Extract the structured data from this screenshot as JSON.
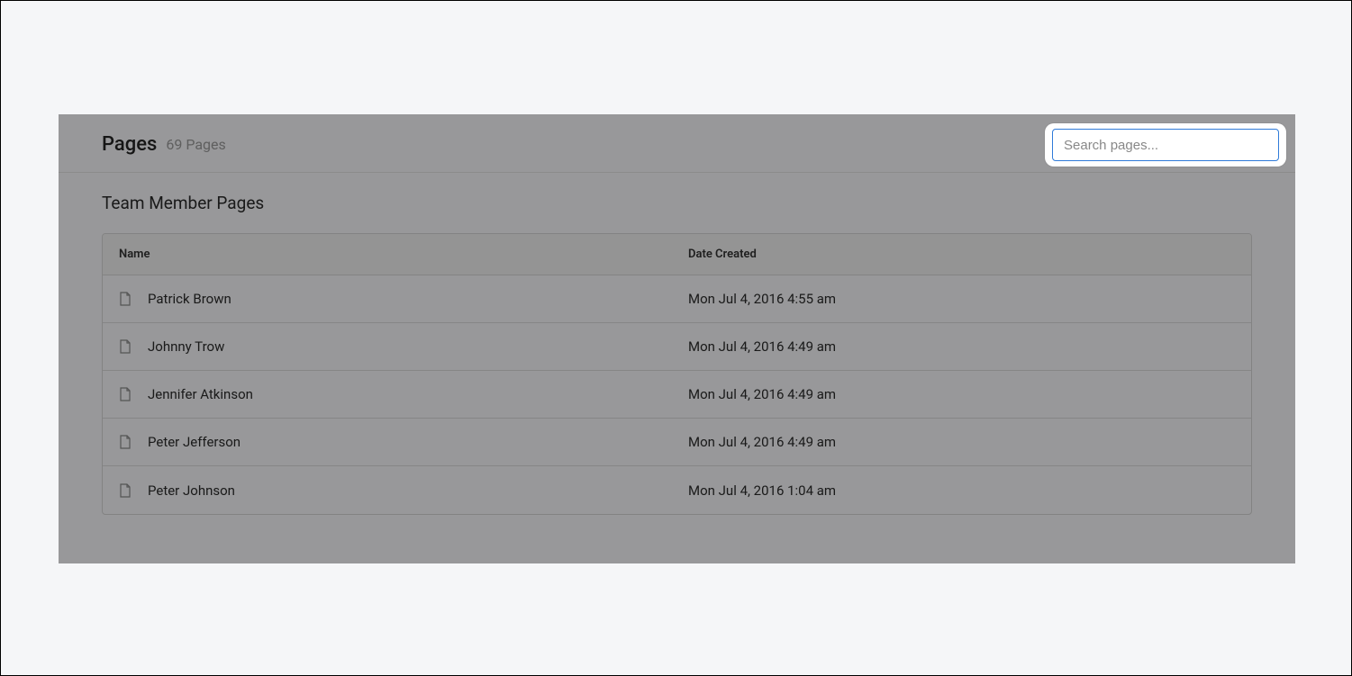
{
  "header": {
    "title": "Pages",
    "subtitle": "69 Pages"
  },
  "search": {
    "placeholder": "Search pages...",
    "value": ""
  },
  "section": {
    "title": "Team Member Pages"
  },
  "table": {
    "columns": {
      "name": "Name",
      "date_created": "Date Created"
    },
    "rows": [
      {
        "name": "Patrick Brown",
        "date_created": "Mon Jul 4, 2016 4:55 am"
      },
      {
        "name": "Johnny Trow",
        "date_created": "Mon Jul 4, 2016 4:49 am"
      },
      {
        "name": "Jennifer Atkinson",
        "date_created": "Mon Jul 4, 2016 4:49 am"
      },
      {
        "name": "Peter Jefferson",
        "date_created": "Mon Jul 4, 2016 4:49 am"
      },
      {
        "name": "Peter Johnson",
        "date_created": "Mon Jul 4, 2016 1:04 am"
      }
    ]
  }
}
